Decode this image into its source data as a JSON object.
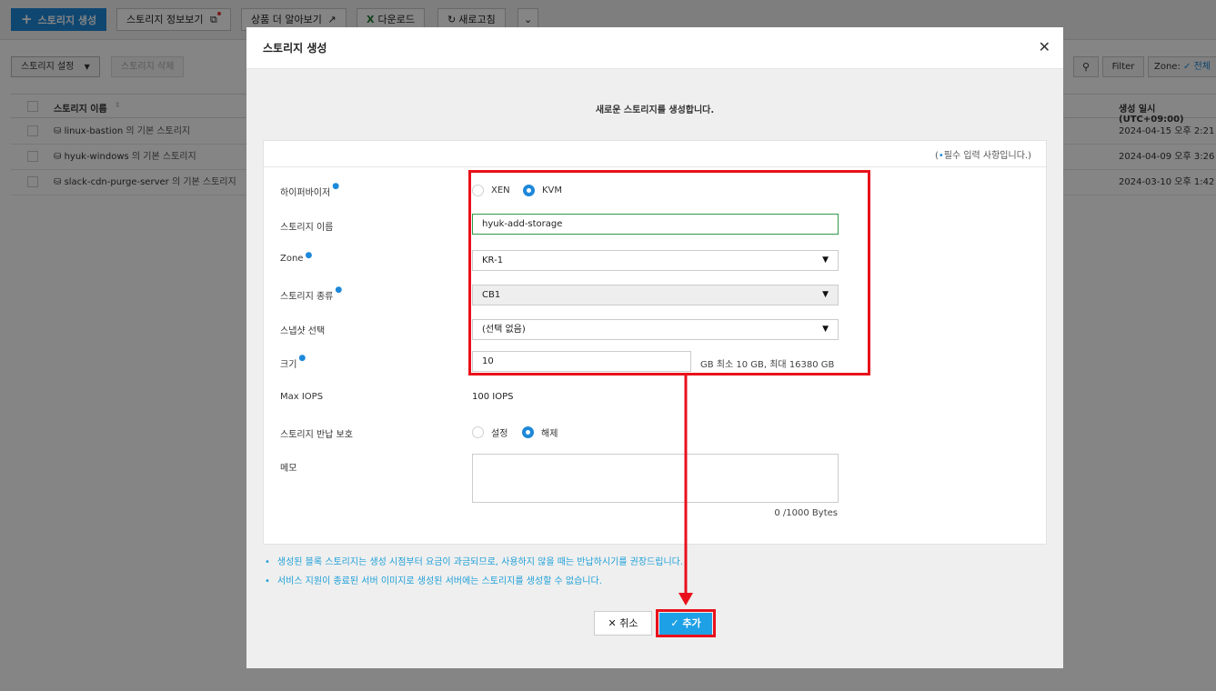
{
  "toolbar": {
    "create_label": "스토리지 생성",
    "info_label": "스토리지 정보보기",
    "learn_more_label": "상품 더 알아보기",
    "download_label": "다운로드",
    "refresh_label": "새로고침"
  },
  "subbar": {
    "settings_label": "스토리지 설정",
    "delete_label": "스토리지 삭제",
    "filter_label": "Filter",
    "zone_label": "Zone:",
    "zone_value": "전체"
  },
  "table": {
    "col_name": "스토리지 이름",
    "col_date": "생성 일시 (UTC+09:00)",
    "rows": [
      {
        "name": "linux-bastion",
        "suffix": "의 기본 스토리지",
        "date": "2024-04-15 오후 2:21"
      },
      {
        "name": "hyuk-windows",
        "suffix": "의 기본 스토리지",
        "date": "2024-04-09 오후 3:26"
      },
      {
        "name": "slack-cdn-purge-server",
        "suffix": "의 기본 스토리지",
        "date": "2024-03-10 오후 1:42"
      }
    ]
  },
  "modal": {
    "title": "스토리지 생성",
    "description": "새로운 스토리지를 생성합니다.",
    "required_note_prefix": "(",
    "required_note_text": "필수 입력 사항입니다.)",
    "fields": {
      "hypervisor_label": "하이퍼바이저",
      "hypervisor_opt1": "XEN",
      "hypervisor_opt2": "KVM",
      "name_label": "스토리지 이름",
      "name_value": "hyuk-add-storage",
      "zone_label": "Zone",
      "zone_value": "KR-1",
      "type_label": "스토리지 종류",
      "type_value": "CB1",
      "snapshot_label": "스냅샷 선택",
      "snapshot_value": "(선택 없음)",
      "size_label": "크기",
      "size_value": "10",
      "size_unit": "GB  최소 10 GB, 최대 16380 GB",
      "iops_label": "Max IOPS",
      "iops_value": "100 IOPS",
      "protect_label": "스토리지 반납 보호",
      "protect_opt1": "설정",
      "protect_opt2": "해제",
      "memo_label": "메모",
      "memo_counter": "0 /1000 Bytes"
    },
    "notes": [
      "생성된 블록 스토리지는 생성 시점부터 요금이 과금되므로, 사용하지 않을 때는 반납하시기를 권장드립니다.",
      "서비스 지원이 종료된 서버 이미지로 생성된 서버에는 스토리지를 생성할 수 없습니다."
    ],
    "cancel_label": "취소",
    "add_label": "추가"
  },
  "colors": {
    "primary": "#1e88d9",
    "annotation": "#e8111b",
    "note_text": "#1ea0d8"
  }
}
